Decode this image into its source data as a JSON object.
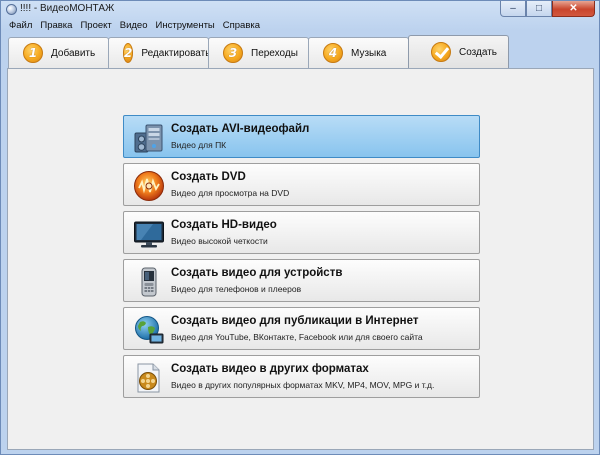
{
  "window": {
    "title": "!!!! - ВидеоМОНТАЖ",
    "minimize_glyph": "–",
    "maximize_glyph": "□",
    "close_glyph": "✕"
  },
  "menu": [
    "Файл",
    "Правка",
    "Проект",
    "Видео",
    "Инструменты",
    "Справка"
  ],
  "tabs": [
    {
      "number": "1",
      "label": "Добавить"
    },
    {
      "number": "2",
      "label": "Редактировать"
    },
    {
      "number": "3",
      "label": "Переходы"
    },
    {
      "number": "4",
      "label": "Музыка"
    },
    {
      "number": "",
      "label": "Создать",
      "active": true
    }
  ],
  "actions": [
    {
      "title": "Создать AVI-видеофайл",
      "subtitle": "Видео для ПК",
      "icon": "pc-speaker-icon",
      "selected": true
    },
    {
      "title": "Создать DVD",
      "subtitle": "Видео для просмотра на DVD",
      "icon": "dvd-disc-icon"
    },
    {
      "title": "Создать HD-видео",
      "subtitle": "Видео высокой четкости",
      "icon": "monitor-icon"
    },
    {
      "title": "Создать видео для устройств",
      "subtitle": "Видео для телефонов и плееров",
      "icon": "phone-icon"
    },
    {
      "title": "Создать видео для публикации в Интернет",
      "subtitle": "Видео для YouTube, ВКонтакте, Facebook или для своего сайта",
      "icon": "globe-icon"
    },
    {
      "title": "Создать видео в других форматах",
      "subtitle": "Видео в других популярных форматах MKV, MP4, MOV, MPG и т.д.",
      "icon": "film-file-icon"
    }
  ],
  "colors": {
    "accent": "#88c4ee",
    "tab_badge": "#f6a91e",
    "close_button": "#c9452d"
  }
}
